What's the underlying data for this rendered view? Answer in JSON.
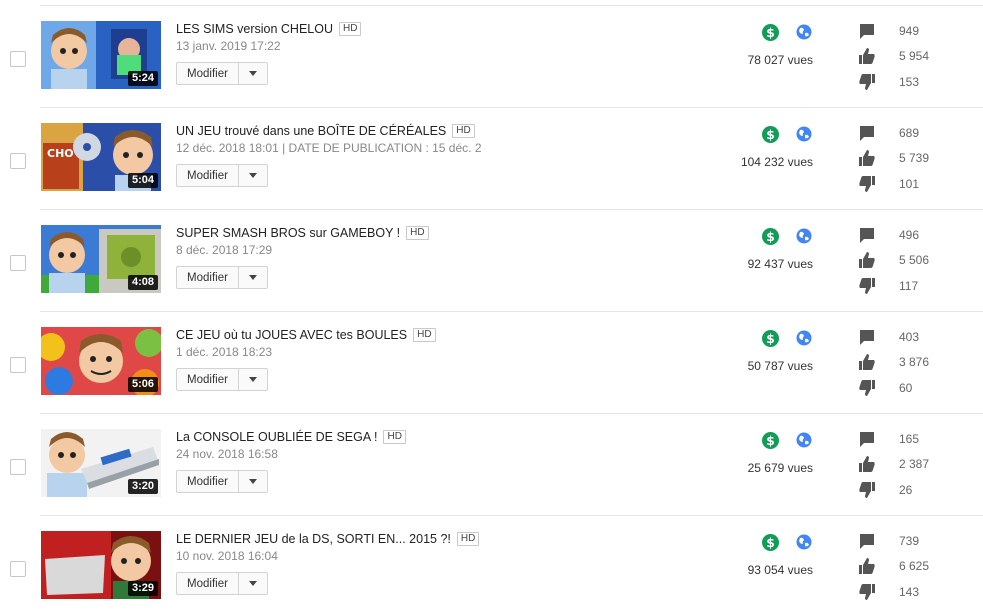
{
  "colors": {
    "monetization": "#0f9d58",
    "visibility": "#4285f4",
    "stat_icon": "#555555"
  },
  "videos": [
    {
      "title": "LES SIMS version CHELOU",
      "hd": "HD",
      "date": "13 janv. 2019 17:22",
      "duration": "5:24",
      "action": "Modifier",
      "views": "78 027 vues",
      "comments": "949",
      "likes": "5 954",
      "dislikes": "153"
    },
    {
      "title": "UN JEU trouvé dans une BOÎTE DE CÉRÉALES",
      "hd": "HD",
      "date": "12 déc. 2018 18:01  |  DATE DE PUBLICATION : 15 déc. 2…",
      "duration": "5:04",
      "action": "Modifier",
      "views": "104 232 vues",
      "comments": "689",
      "likes": "5 739",
      "dislikes": "101"
    },
    {
      "title": "SUPER SMASH BROS sur GAMEBOY !",
      "hd": "HD",
      "date": "8 déc. 2018 17:29",
      "duration": "4:08",
      "action": "Modifier",
      "views": "92 437 vues",
      "comments": "496",
      "likes": "5 506",
      "dislikes": "117"
    },
    {
      "title": "CE JEU où tu JOUES AVEC tes BOULES",
      "hd": "HD",
      "date": "1 déc. 2018 18:23",
      "duration": "5:06",
      "action": "Modifier",
      "views": "50 787 vues",
      "comments": "403",
      "likes": "3 876",
      "dislikes": "60"
    },
    {
      "title": "La CONSOLE OUBLIÉE DE SEGA !",
      "hd": "HD",
      "date": "24 nov. 2018 16:58",
      "duration": "3:20",
      "action": "Modifier",
      "views": "25 679 vues",
      "comments": "165",
      "likes": "2 387",
      "dislikes": "26"
    },
    {
      "title": "LE DERNIER JEU de la DS, SORTI EN... 2015 ?!",
      "hd": "HD",
      "date": "10 nov. 2018 16:04",
      "duration": "3:29",
      "action": "Modifier",
      "views": "93 054 vues",
      "comments": "739",
      "likes": "6 625",
      "dislikes": "143"
    }
  ]
}
